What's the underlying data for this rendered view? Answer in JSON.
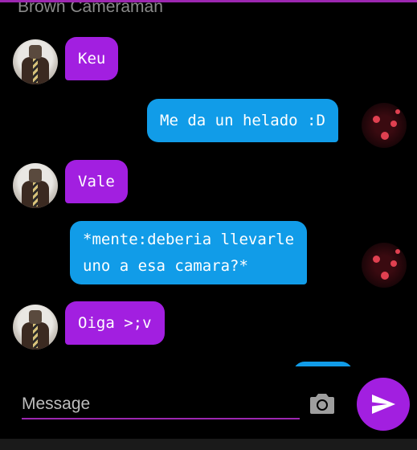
{
  "header": {
    "title": "Brown Cameraman"
  },
  "messages": [
    {
      "side": "in",
      "text": "Keu"
    },
    {
      "side": "out",
      "text": "Me da un helado :D"
    },
    {
      "side": "in",
      "text": "Vale"
    },
    {
      "side": "out",
      "line1": "*mente:deberia llevarle",
      "line2": "uno a esa camara?*"
    },
    {
      "side": "in",
      "text": "Oiga >;v"
    }
  ],
  "composer": {
    "placeholder": "Message"
  },
  "colors": {
    "accent": "#9c27b0",
    "bubble_in": "#a21fe0",
    "bubble_out": "#119ce8",
    "background": "#000000"
  },
  "icons": {
    "camera": "camera-icon",
    "send": "send-icon"
  }
}
